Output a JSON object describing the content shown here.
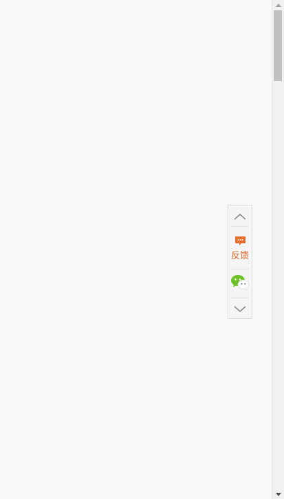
{
  "page": {
    "background": "#f8f8f8"
  },
  "side_toolbar": {
    "scroll_up_icon": "chevron-up-icon",
    "feedback": {
      "icon": "chat-bubble-icon",
      "label": "反馈",
      "color": "#e0662a"
    },
    "wechat_icon": "wechat-icon",
    "scroll_down_icon": "chevron-down-icon"
  },
  "scrollbar": {
    "up_arrow_icon": "scroll-up-arrow-icon",
    "down_arrow_icon": "scroll-down-arrow-icon",
    "scroll_position": 0
  }
}
